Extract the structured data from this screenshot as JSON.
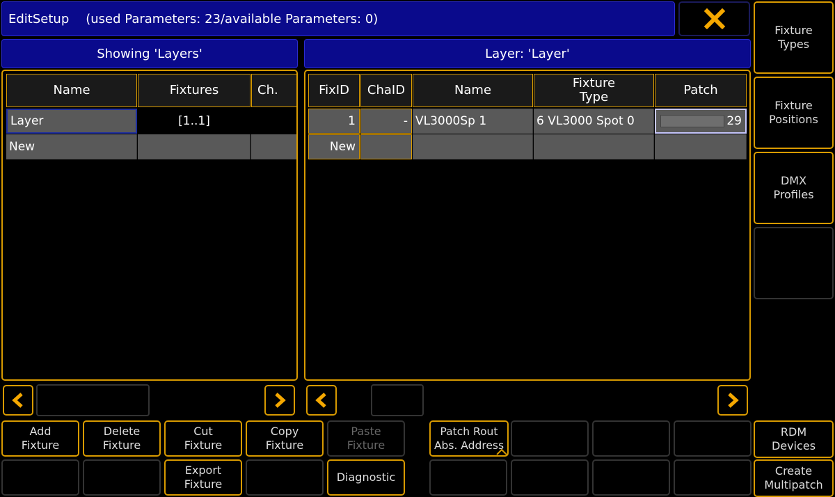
{
  "title": {
    "app": "EditSetup",
    "params": "(used Parameters: 23/available Parameters: 0)"
  },
  "left_panel": {
    "header": "Showing 'Layers'",
    "columns": [
      "Name",
      "Fixtures",
      "Ch."
    ],
    "rows": [
      {
        "name": "Layer",
        "fixtures": "[1..1]",
        "ch": ""
      },
      {
        "name": "New",
        "fixtures": "",
        "ch": ""
      }
    ]
  },
  "right_panel": {
    "header": "Layer: 'Layer'",
    "columns": [
      "FixID",
      "ChaID",
      "Name",
      "Fixture\nType",
      "Patch"
    ],
    "rows": [
      {
        "fixid": "1",
        "chaid": "-",
        "name": "VL3000Sp 1",
        "type": "6 VL3000 Spot 0",
        "patch": "29"
      },
      {
        "fixid": "New",
        "chaid": "",
        "name": "",
        "type": "",
        "patch": ""
      }
    ]
  },
  "side_buttons": [
    {
      "label": "Fixture\nTypes"
    },
    {
      "label": "Fixture\nPositions"
    },
    {
      "label": "DMX\nProfiles"
    },
    {
      "label": ""
    },
    {
      "label": "RDM\nDevices"
    },
    {
      "label": "Create\nMultipatch"
    }
  ],
  "bottom_buttons": {
    "row1": [
      "Add\nFixture",
      "Delete\nFixture",
      "Cut\nFixture",
      "Copy\nFixture",
      "Paste\nFixture",
      "Patch Rout\nAbs. Address",
      "",
      "",
      ""
    ],
    "row2": [
      "",
      "",
      "Export\nFixture",
      "",
      "Diagnostic",
      "",
      "",
      "",
      ""
    ]
  },
  "colors": {
    "accent": "#d89a00",
    "title_blue": "#0a0a8c",
    "cell_gray": "#595959",
    "close_icon": "#f5a800"
  },
  "icons": {
    "close": "close-icon",
    "scroll_left": "chevron-left-icon",
    "scroll_right": "chevron-right-icon"
  }
}
